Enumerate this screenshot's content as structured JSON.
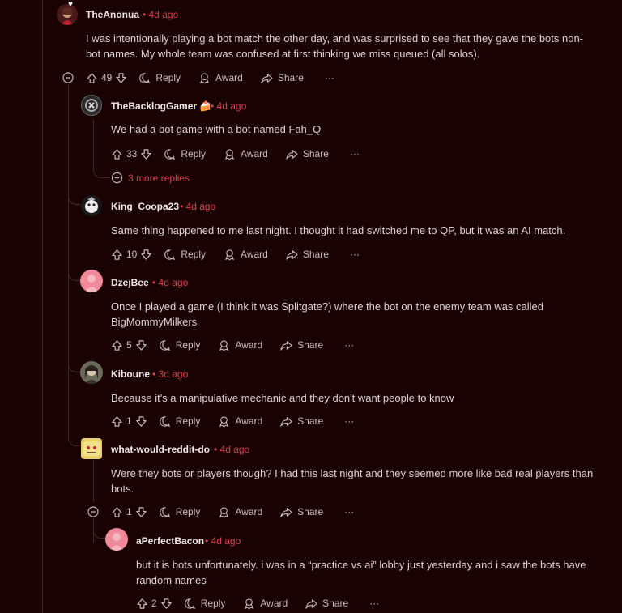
{
  "comments": [
    {
      "user": "TheAnonua",
      "time": "4d ago",
      "body": "I was intentionally playing a bot match the other day, and was surprised to see that they gave the bots non-bot names. My whole team was confused at first thinking we miss queued (all solos).",
      "votes": "49"
    },
    {
      "user": "TheBacklogGamer",
      "time": "4d ago",
      "body": "We had a bot game with a bot named Fah_Q",
      "votes": "33"
    },
    {
      "user": "King_Coopa23",
      "time": "4d ago",
      "body": "Same thing happened to me last night. I thought it had switched me to QP, but it was an AI match.",
      "votes": "10"
    },
    {
      "user": "DzejBee",
      "time": "4d ago",
      "body": "Once I played a game (I think it was Splitgate?) where the bot on the enemy team was called BigMommyMilkers",
      "votes": "5"
    },
    {
      "user": "Kiboune",
      "time": "3d ago",
      "body": "Because it's a manipulative mechanic and they don't want people to know",
      "votes": "1"
    },
    {
      "user": "what-would-reddit-do",
      "time": "4d ago",
      "body": "Were they bots or players though? I had this last night and they seemed more like bad real players than bots.",
      "votes": "1"
    },
    {
      "user": "aPerfectBacon",
      "time": "4d ago",
      "body": "but it is bots unfortunately. i was in a “practice vs ai” lobby just yesterday and i saw the bots have random names",
      "votes": "2"
    }
  ],
  "labels": {
    "reply": "Reply",
    "award": "Award",
    "share": "Share",
    "more": "···",
    "more_replies": "3 more replies",
    "separator": "•"
  },
  "colors": {
    "background": "#1a0203",
    "accent": "#d8404a",
    "thread_line": "#4a2426"
  },
  "icons": [
    "upvote-icon",
    "downvote-icon",
    "reply-icon",
    "award-icon",
    "share-icon",
    "collapse-icon",
    "plus-circle-icon"
  ]
}
